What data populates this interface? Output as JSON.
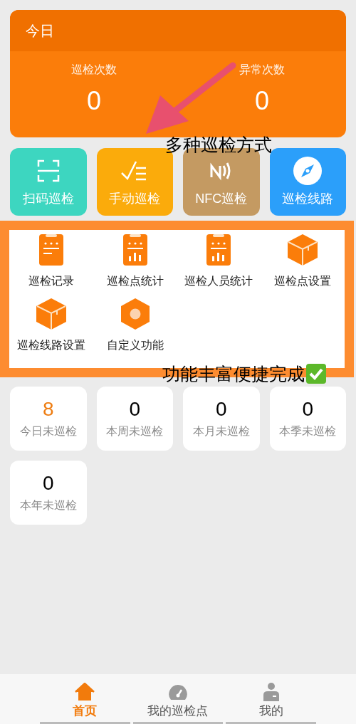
{
  "today_card": {
    "title": "今日",
    "stats": [
      {
        "label": "巡检次数",
        "value": "0"
      },
      {
        "label": "异常次数",
        "value": "0"
      }
    ]
  },
  "quick_actions": [
    {
      "label": "扫码巡检",
      "color": "#3dd6c0",
      "kind": "scan"
    },
    {
      "label": "手动巡检",
      "color": "#fbab0b",
      "kind": "manual"
    },
    {
      "label": "NFC巡检",
      "color": "#c49a62",
      "kind": "nfc"
    },
    {
      "label": "巡检线路",
      "color": "#2b9ffa",
      "kind": "compass"
    }
  ],
  "functions": [
    {
      "label": "巡检记录",
      "kind": "clipboard"
    },
    {
      "label": "巡检点统计",
      "kind": "chart"
    },
    {
      "label": "巡检人员统计",
      "kind": "chart"
    },
    {
      "label": "巡检点设置",
      "kind": "box"
    },
    {
      "label": "巡检线路设置",
      "kind": "box"
    },
    {
      "label": "自定义功能",
      "kind": "hexagon"
    }
  ],
  "pending": [
    {
      "value": "8",
      "label": "今日未巡检",
      "alert": true
    },
    {
      "value": "0",
      "label": "本周未巡检",
      "alert": false
    },
    {
      "value": "0",
      "label": "本月未巡检",
      "alert": false
    },
    {
      "value": "0",
      "label": "本季未巡检",
      "alert": false
    },
    {
      "value": "0",
      "label": "本年未巡检",
      "alert": false
    }
  ],
  "annotations": [
    {
      "text": "多种巡检方式",
      "check": false
    },
    {
      "text": "功能丰富便捷完成",
      "check": true
    }
  ],
  "tab_bar": [
    {
      "label": "首页",
      "kind": "home",
      "selected": true
    },
    {
      "label": "我的巡检点",
      "kind": "gauge",
      "selected": false
    },
    {
      "label": "我的",
      "kind": "person",
      "selected": false
    }
  ]
}
